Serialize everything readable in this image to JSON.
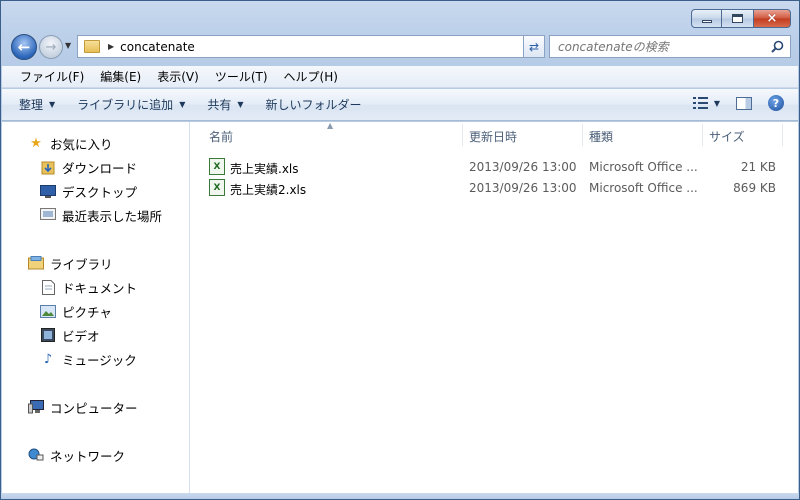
{
  "window": {
    "caption": {
      "minimize": "minimize",
      "maximize": "maximize",
      "close": "×"
    }
  },
  "address": {
    "path_segment": "concatenate",
    "search_placeholder": "concatenateの検索"
  },
  "menubar": {
    "items": [
      "ファイル(F)",
      "編集(E)",
      "表示(V)",
      "ツール(T)",
      "ヘルプ(H)"
    ]
  },
  "commandbar": {
    "items": [
      "整理",
      "ライブラリに追加",
      "共有",
      "新しいフォルダー"
    ]
  },
  "navpane": {
    "favorites": {
      "label": "お気に入り",
      "items": [
        "ダウンロード",
        "デスクトップ",
        "最近表示した場所"
      ]
    },
    "libraries": {
      "label": "ライブラリ",
      "items": [
        "ドキュメント",
        "ピクチャ",
        "ビデオ",
        "ミュージック"
      ]
    },
    "computer": {
      "label": "コンピューター"
    },
    "network": {
      "label": "ネットワーク"
    }
  },
  "filelist": {
    "columns": [
      "名前",
      "更新日時",
      "種類",
      "サイズ"
    ],
    "rows": [
      {
        "name": "売上実績.xls",
        "modified": "2013/09/26 13:00",
        "type": "Microsoft Office ...",
        "size": "21 KB"
      },
      {
        "name": "売上実績2.xls",
        "modified": "2013/09/26 13:00",
        "type": "Microsoft Office ...",
        "size": "869 KB"
      }
    ]
  },
  "colors": {
    "frame": "#b6cbe6",
    "accent": "#1e395b",
    "header_text": "#4c607a"
  }
}
